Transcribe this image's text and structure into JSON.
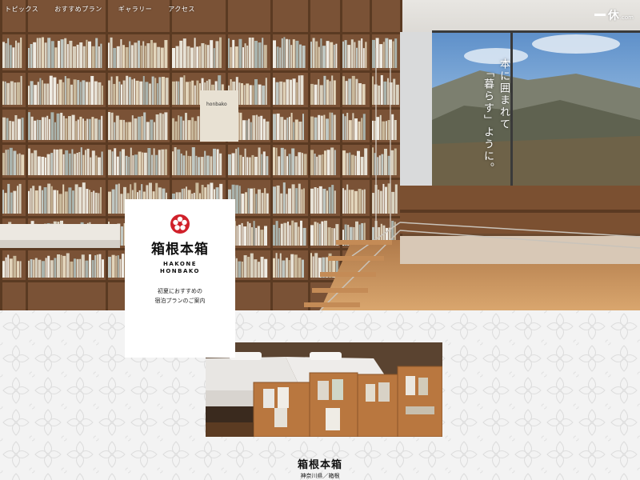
{
  "nav": {
    "items": [
      "トピックス",
      "おすすめプラン",
      "ギャラリー",
      "アクセス"
    ]
  },
  "site_logo": {
    "kanji": "休",
    "domain": ".com"
  },
  "catch_copy": {
    "line1": "本に囲まれて",
    "line2": "「暮らす」ように。"
  },
  "card": {
    "brand_jp": "箱根本箱",
    "brand_en_1": "HAKONE",
    "brand_en_2": "HONBAKO",
    "plan_line1": "初夏におすすめの",
    "plan_line2": "宿泊プランのご案内"
  },
  "caption": {
    "name": "箱根本箱",
    "location": "神奈川県／箱根"
  },
  "colors": {
    "accent_red": "#d0202a",
    "wood": "#8a5a36",
    "text": "#111111"
  }
}
